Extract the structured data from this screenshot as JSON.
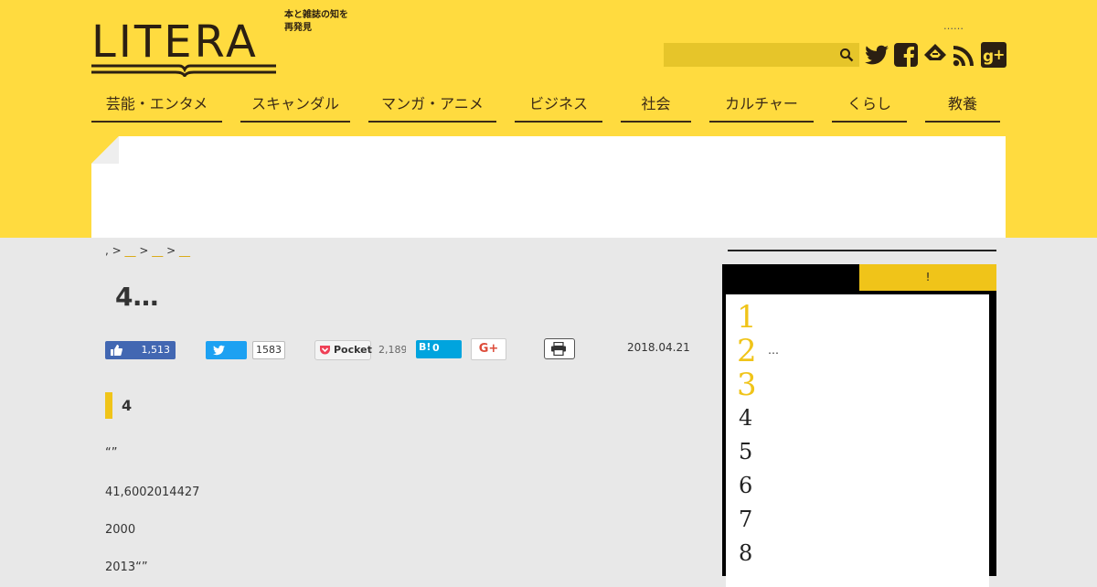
{
  "header": {
    "logo_word": "LITERA",
    "logo_tagline": "本と雑誌の知を再発見",
    "header_dots": "……",
    "search": {
      "placeholder": "",
      "value": ""
    },
    "social_icons": [
      "twitter-icon",
      "facebook-icon",
      "feedly-icon",
      "rss-icon",
      "google-plus-icon"
    ]
  },
  "nav": {
    "items": [
      {
        "label": "芸能・エンタメ"
      },
      {
        "label": "スキャンダル"
      },
      {
        "label": "マンガ・アニメ"
      },
      {
        "label": "ビジネス"
      },
      {
        "label": "社会"
      },
      {
        "label": "カルチャー"
      },
      {
        "label": "くらし"
      },
      {
        "label": "教養"
      }
    ]
  },
  "breadcrumb": {
    "home": ",",
    "sep": ">",
    "crumbs": [
      "__",
      "__",
      "__"
    ]
  },
  "article": {
    "title": "4…",
    "share": {
      "like_count": "1,513",
      "tweet_count": "1583",
      "pocket_label": "Pocket",
      "pocket_count": "2,189",
      "hatena_label": "B!",
      "hatena_count": "0",
      "gplus_label": "G+"
    },
    "date": "2018.04.21",
    "subhead": "4",
    "paragraphs": [
      "“”",
      "41,6002014427",
      "2000",
      "2013“”"
    ]
  },
  "sidebar": {
    "tabs": [
      {
        "label": "",
        "active": true
      },
      {
        "label": "!",
        "active": false
      }
    ],
    "ranking": {
      "numbers": [
        "1",
        "2",
        "3",
        "4",
        "5",
        "6",
        "7",
        "8"
      ],
      "first_text": "…"
    }
  },
  "colors": {
    "brand_yellow": "#ffdb3f",
    "accent_yellow": "#f0c419",
    "logo_dark": "#2b1f12",
    "facebook_blue": "#4267b2",
    "twitter_blue": "#1da1f2",
    "hatena_blue": "#00a4de"
  }
}
